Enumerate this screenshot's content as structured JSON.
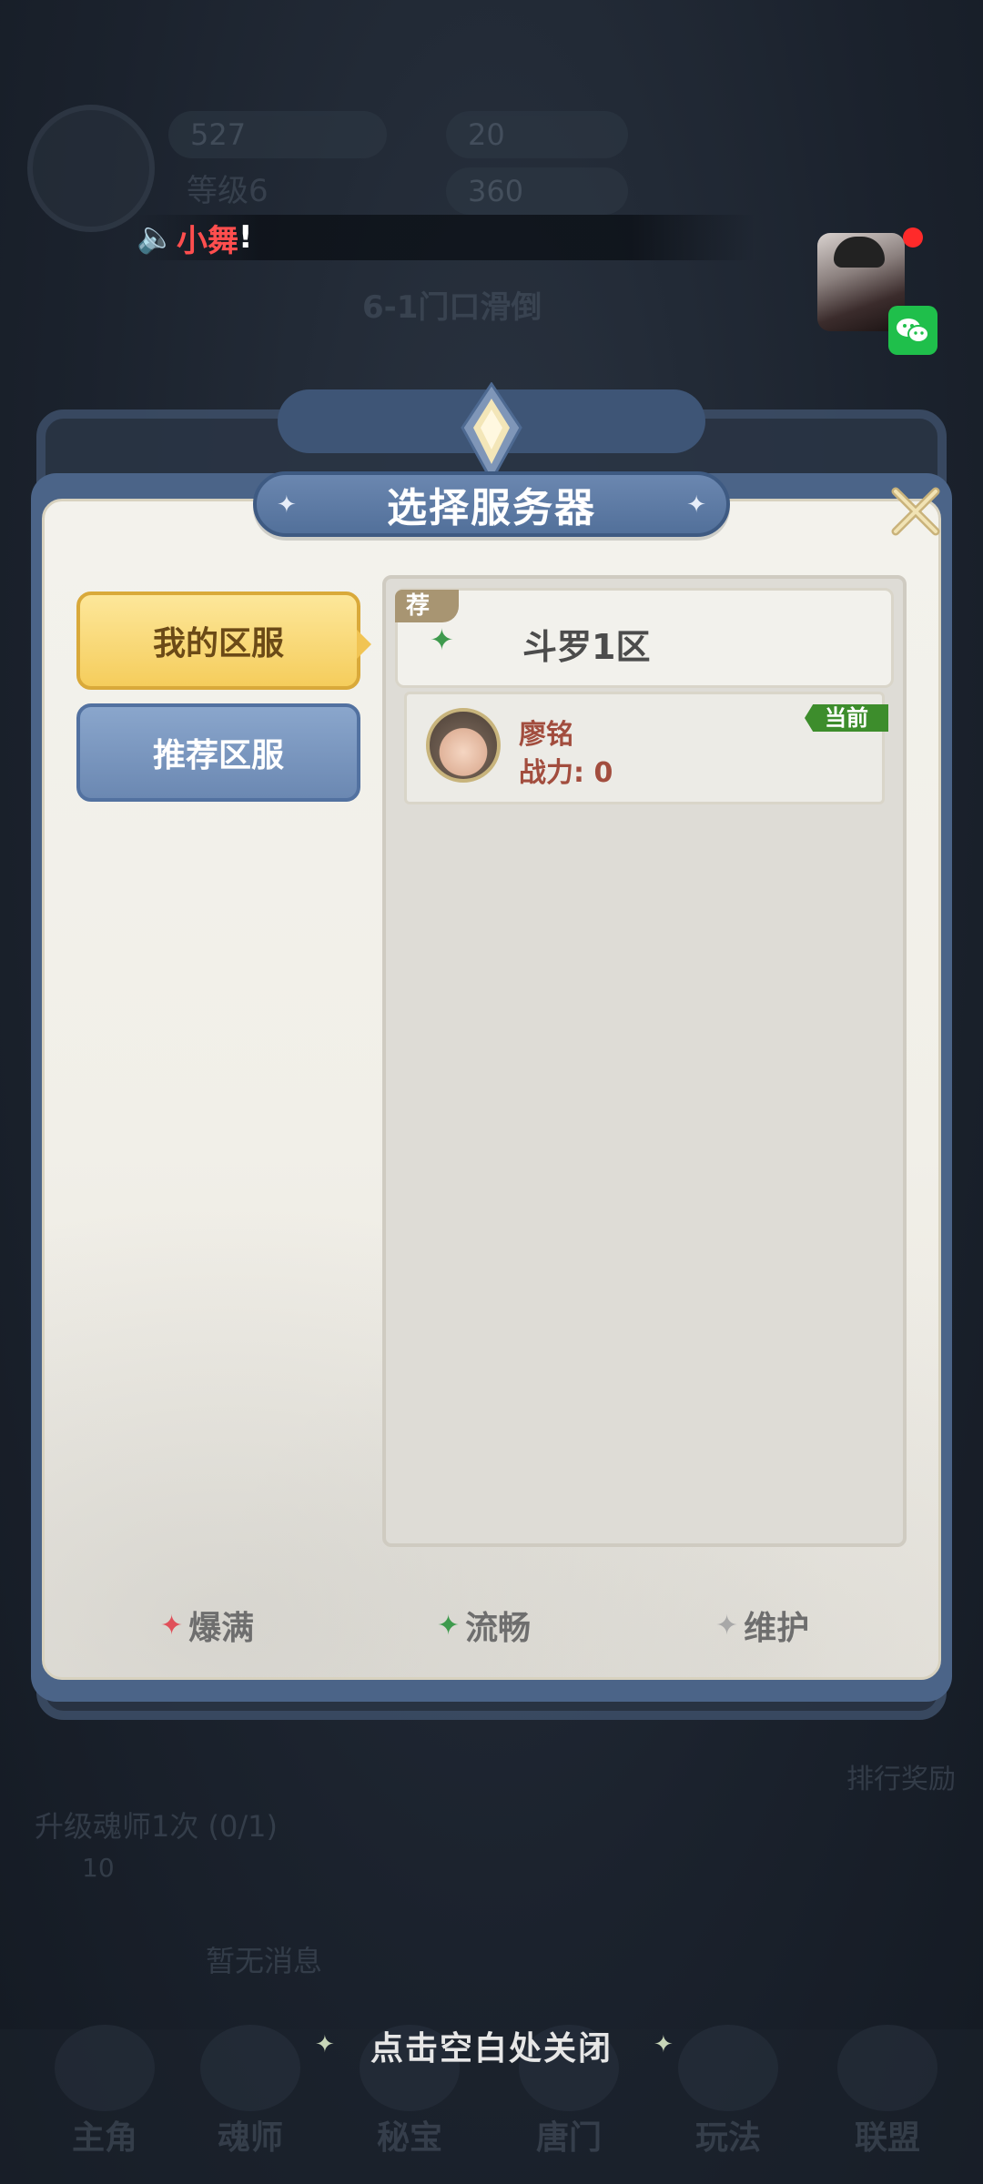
{
  "marquee": {
    "speaker_icon": "speaker-icon",
    "text": "小舞",
    "suffix": "!"
  },
  "background": {
    "stat_1": "527",
    "stat_2": "等级6",
    "currency_1": "20",
    "currency_2": "360",
    "stage_title": "6-1门口滑倒",
    "quest": "升级魂师1次 (0/1)",
    "quest_reward": "10",
    "news": "暂无消息",
    "side_label": "排行奖励",
    "nav": [
      "主角",
      "魂师",
      "秘宝",
      "唐门",
      "玩法",
      "联盟"
    ]
  },
  "dialog": {
    "title": "选择服务器",
    "tabs": {
      "mine": "我的区服",
      "recommended": "推荐区服"
    },
    "server": {
      "tag": "荐",
      "name": "斗罗1区",
      "status_color": "#3e9a4d"
    },
    "character": {
      "name": "廖铭",
      "power": "战力: 0",
      "current_tag": "当前"
    },
    "legend": [
      {
        "label": "爆满",
        "color": "#e0505a"
      },
      {
        "label": "流畅",
        "color": "#3e9a4d"
      },
      {
        "label": "维护",
        "color": "#a8a8a8"
      }
    ]
  },
  "close_hint": "点击空白处关闭",
  "colors": {
    "accent_gold": "#f5cd5c",
    "accent_blue": "#52709a"
  }
}
